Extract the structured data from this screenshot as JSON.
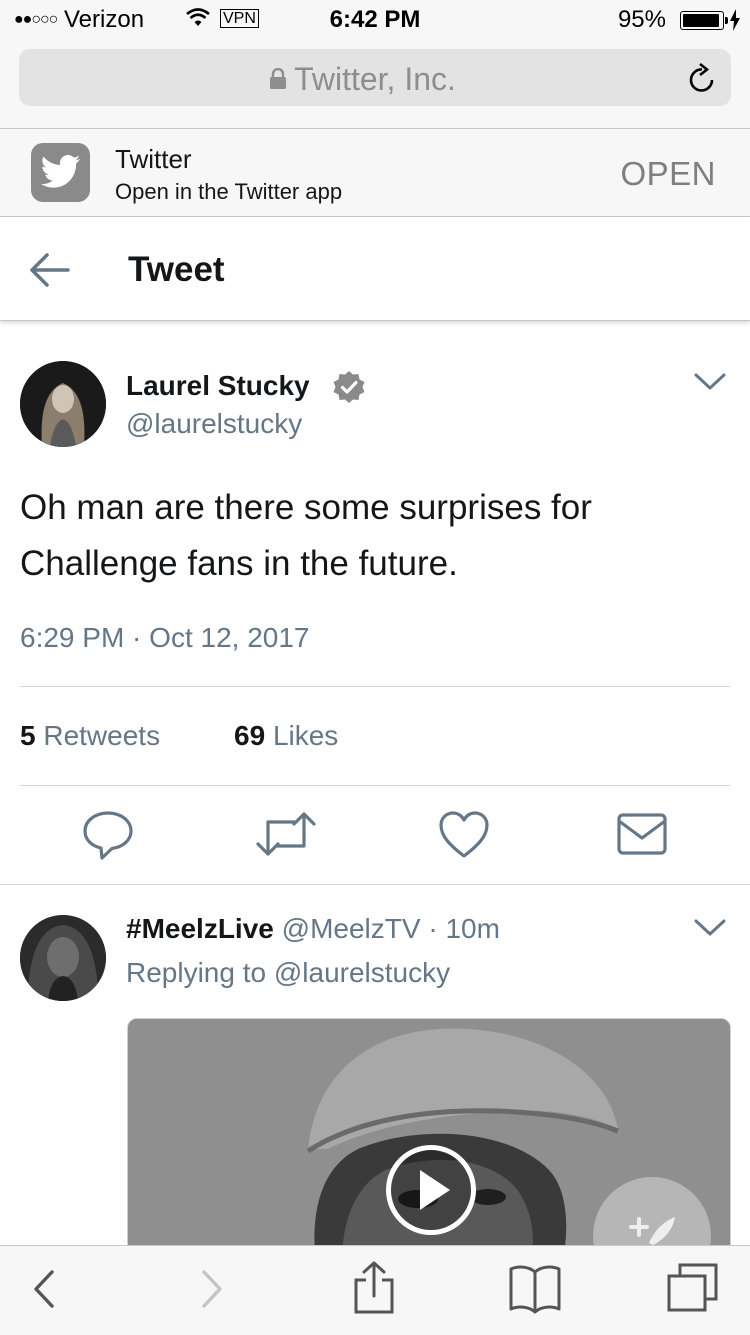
{
  "status_bar": {
    "carrier": "Verizon",
    "vpn": "VPN",
    "time": "6:42 PM",
    "battery_percent": "95%",
    "battery_level": 0.95,
    "signal_dots": "●●○○○"
  },
  "browser": {
    "url_title": "Twitter, Inc."
  },
  "app_banner": {
    "app_name": "Twitter",
    "subtitle": "Open in the Twitter app",
    "open_label": "OPEN"
  },
  "header": {
    "title": "Tweet"
  },
  "tweet": {
    "author_name": "Laurel Stucky",
    "author_handle": "@laurelstucky",
    "verified": true,
    "text": "Oh man are there some surprises for Challenge fans in the future.",
    "timestamp": "6:29 PM · Oct 12, 2017",
    "retweets_count": "5",
    "retweets_label": "Retweets",
    "likes_count": "69",
    "likes_label": "Likes"
  },
  "actions": [
    {
      "icon": "reply-icon"
    },
    {
      "icon": "retweet-icon"
    },
    {
      "icon": "like-icon"
    },
    {
      "icon": "message-icon"
    }
  ],
  "reply": {
    "author_name": "#MeelzLive",
    "author_handle": "@MeelzTV",
    "separator": "·",
    "time_ago": "10m",
    "replying_to": "Replying to @laurelstucky"
  },
  "colors": {
    "secondary_text": "#657786",
    "primary_text": "#14171a",
    "chrome_bg": "#f7f7f7"
  }
}
